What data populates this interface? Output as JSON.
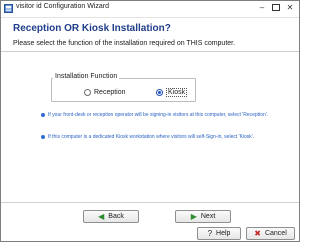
{
  "window": {
    "title": "visitor id Configuration Wizard",
    "minimize_glyph": "–",
    "close_glyph": "✕"
  },
  "header": {
    "heading": "Reception OR Kiosk Installation?",
    "subheading": "Please select the function of the installation required on THIS computer."
  },
  "installation_function": {
    "legend": "Installation Function",
    "options": [
      {
        "label": "Reception",
        "selected": false
      },
      {
        "label": "Kiosk",
        "selected": true
      }
    ]
  },
  "notes": [
    "If your front-desk or reception operator will be signing-in visitors at this computer, select 'Reception'.",
    "If this computer is a dedicated Kiosk workstation where visitors will self-Sign-in, select 'Kiosk'."
  ],
  "footer": {
    "back_label": "Back",
    "back_icon_glyph": "◀",
    "next_label": "Next",
    "next_icon_glyph": "▶",
    "help_label": "Help",
    "help_icon_glyph": "?",
    "cancel_label": "Cancel",
    "cancel_icon_glyph": "✖"
  },
  "icons": {
    "app": "visitor-id-app-icon",
    "back": "back-arrow-icon",
    "next": "next-arrow-icon",
    "help": "help-icon",
    "cancel": "cancel-icon"
  },
  "colors": {
    "heading": "#1f3d8a",
    "note_text": "#2b62c4",
    "bullet": "#2f6ed0",
    "arrow_green": "#2e8b2e",
    "cancel_red": "#c62828"
  }
}
